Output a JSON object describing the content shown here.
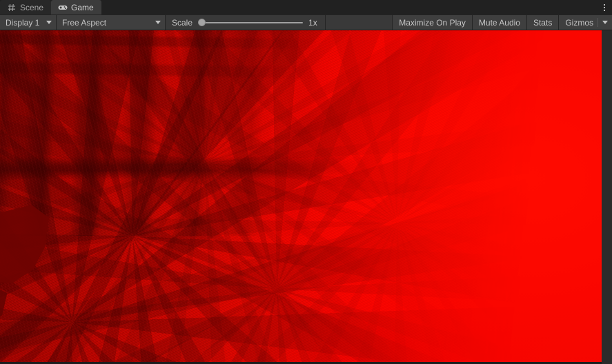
{
  "window": {
    "menu_icon": "kebab-menu-icon"
  },
  "tabs": [
    {
      "label": "Scene",
      "icon": "grid-icon",
      "active": false
    },
    {
      "label": "Game",
      "icon": "gamepad-icon",
      "active": true
    }
  ],
  "toolbar": {
    "display_dropdown": {
      "value": "Display 1",
      "icon": "chevron-down-icon"
    },
    "aspect_dropdown": {
      "value": "Free Aspect",
      "icon": "chevron-down-icon"
    },
    "scale": {
      "label": "Scale",
      "value": "1x",
      "slider_position_percent": 0,
      "min": "1x",
      "max": "5x"
    },
    "maximize_on_play": "Maximize On Play",
    "mute_audio": "Mute Audio",
    "stats": "Stats",
    "gizmos": "Gizmos",
    "gizmos_caret_icon": "chevron-down-icon"
  },
  "game_view": {
    "description": "Rendered game camera output fully washed in saturated red; vertical tree-trunk silhouettes at the left, a dark angular foreground object at the lower left, fading to flat bright red toward the right.",
    "colors": {
      "red_primary": "#ff0500",
      "red_mid": "#e40600",
      "red_dark": "#9e0400",
      "silhouette": "#6e0301"
    }
  },
  "colors": {
    "tab_strip_bg": "#212121",
    "tab_active_bg": "#3c3c3c",
    "tab_inactive_bg": "#282828",
    "toolbar_bg": "#393939",
    "toolbar_button_bg": "#3f3f3f",
    "panel_bg": "#2b2b2b",
    "text": "#c4c4c4",
    "border": "#242424"
  }
}
